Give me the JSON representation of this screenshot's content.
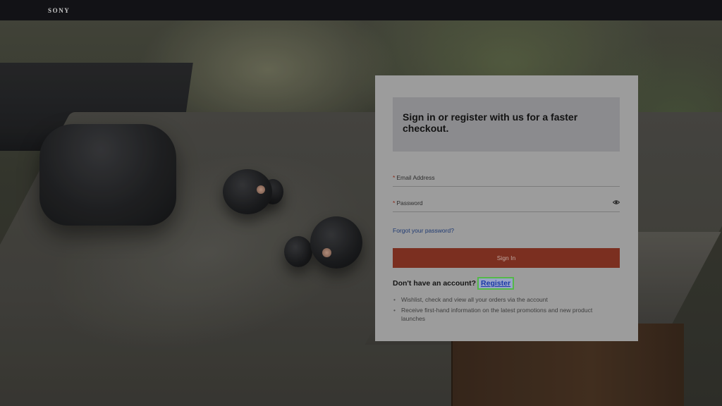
{
  "header": {
    "brand": "SONY"
  },
  "signin": {
    "heading": "Sign in or register with us for a faster checkout.",
    "email_label": "Email Address",
    "password_label": "Password",
    "required_mark": "*",
    "forgot_link": "Forgot your password?",
    "signin_button": "Sign In",
    "no_account_text": "Don't have an account?",
    "register_link": "Register",
    "benefits": [
      "Wishlist, check and view all your orders via the account",
      "Receive first-hand information on the latest promotions and new product launches"
    ]
  },
  "colors": {
    "signin_button": "#7b2f20",
    "register_highlight": "#55b848",
    "link": "#1f3a72"
  }
}
